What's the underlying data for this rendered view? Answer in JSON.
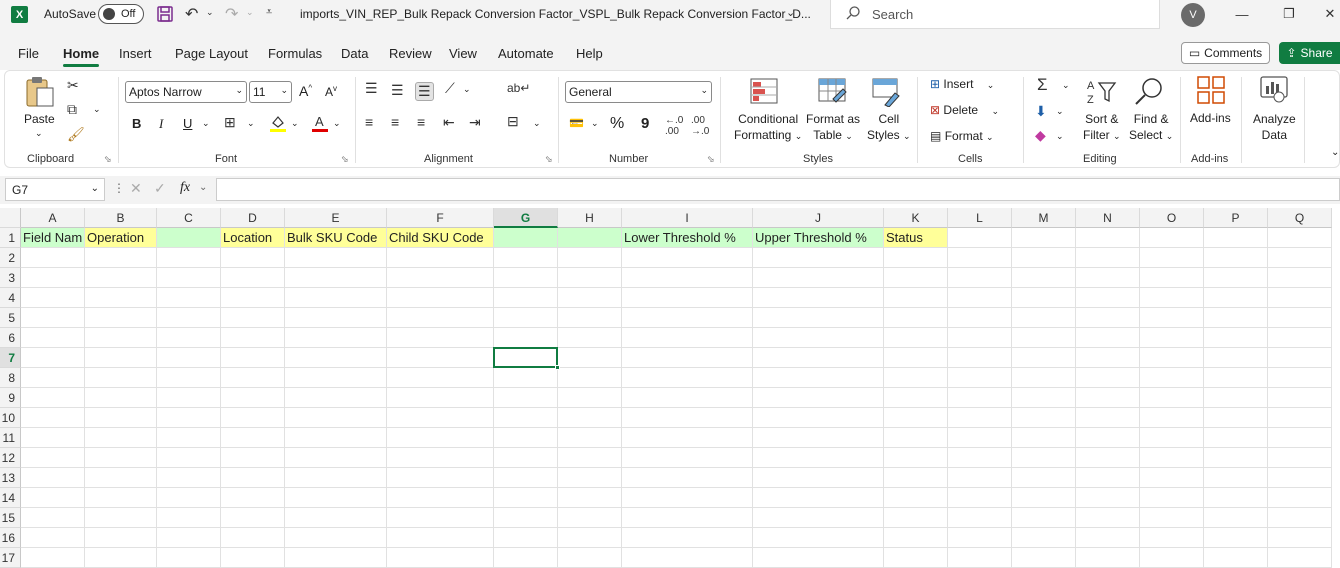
{
  "titlebar": {
    "app_icon": "excel-icon",
    "autosave_label": "AutoSave",
    "autosave_state": "Off",
    "doc_title": "imports_VIN_REP_Bulk Repack Conversion Factor_VSPL_Bulk Repack Conversion Factor_D...",
    "search_placeholder": "Search",
    "avatar_initial": "V"
  },
  "menu": {
    "tabs": [
      "File",
      "Home",
      "Insert",
      "Page Layout",
      "Formulas",
      "Data",
      "Review",
      "View",
      "Automate",
      "Help"
    ],
    "active": "Home",
    "comments_label": "Comments",
    "share_label": "Share"
  },
  "ribbon": {
    "clipboard": {
      "paste": "Paste",
      "label": "Clipboard"
    },
    "font": {
      "name": "Aptos Narrow",
      "size": "11",
      "label": "Font",
      "bold": "B",
      "italic": "I",
      "underline": "U",
      "grow": "A",
      "shrink": "A"
    },
    "alignment": {
      "label": "Alignment"
    },
    "number": {
      "format": "General",
      "label": "Number",
      "percent": "%",
      "comma": "9"
    },
    "styles": {
      "conditional_l1": "Conditional",
      "conditional_l2": "Formatting",
      "format_table_l1": "Format as",
      "format_table_l2": "Table",
      "cell_styles_l1": "Cell",
      "cell_styles_l2": "Styles",
      "label": "Styles"
    },
    "cells": {
      "insert": "Insert",
      "delete": "Delete",
      "format": "Format",
      "label": "Cells"
    },
    "editing": {
      "sort_l1": "Sort &",
      "sort_l2": "Filter",
      "find_l1": "Find &",
      "find_l2": "Select",
      "label": "Editing"
    },
    "addins": {
      "addins": "Add-ins",
      "label": "Add-ins"
    },
    "analyze": {
      "l1": "Analyze",
      "l2": "Data"
    }
  },
  "formula_bar": {
    "name_box": "G7",
    "fx": "fx",
    "content": ""
  },
  "sheet": {
    "columns": [
      "A",
      "B",
      "C",
      "D",
      "E",
      "F",
      "G",
      "H",
      "I",
      "J",
      "K",
      "L",
      "M",
      "N",
      "O",
      "P",
      "Q"
    ],
    "rows": [
      "1",
      "2",
      "3",
      "4",
      "5",
      "6",
      "7",
      "8",
      "9",
      "10",
      "11",
      "12",
      "13",
      "14",
      "15",
      "16",
      "17"
    ],
    "selected_cell": "G7",
    "row1": [
      {
        "col": "A",
        "text": "Field Nam",
        "fill": "#ccffcc"
      },
      {
        "col": "B",
        "text": "Operation",
        "fill": "#ffff99"
      },
      {
        "col": "C",
        "text": "",
        "fill": "#ccffcc"
      },
      {
        "col": "D",
        "text": "Location",
        "fill": "#ffff99"
      },
      {
        "col": "E",
        "text": "Bulk SKU Code",
        "fill": "#ffff99"
      },
      {
        "col": "F",
        "text": "Child SKU Code",
        "fill": "#ffff99"
      },
      {
        "col": "G",
        "text": "",
        "fill": "#ccffcc"
      },
      {
        "col": "H",
        "text": "",
        "fill": "#ccffcc"
      },
      {
        "col": "I",
        "text": "Lower Threshold %",
        "fill": "#ccffcc"
      },
      {
        "col": "J",
        "text": "Upper Threshold %",
        "fill": "#ccffcc"
      },
      {
        "col": "K",
        "text": "Status",
        "fill": "#ffff99"
      }
    ],
    "colors": {
      "accent": "#107c41",
      "green_fill": "#ccffcc",
      "yellow_fill": "#ffff99"
    }
  }
}
